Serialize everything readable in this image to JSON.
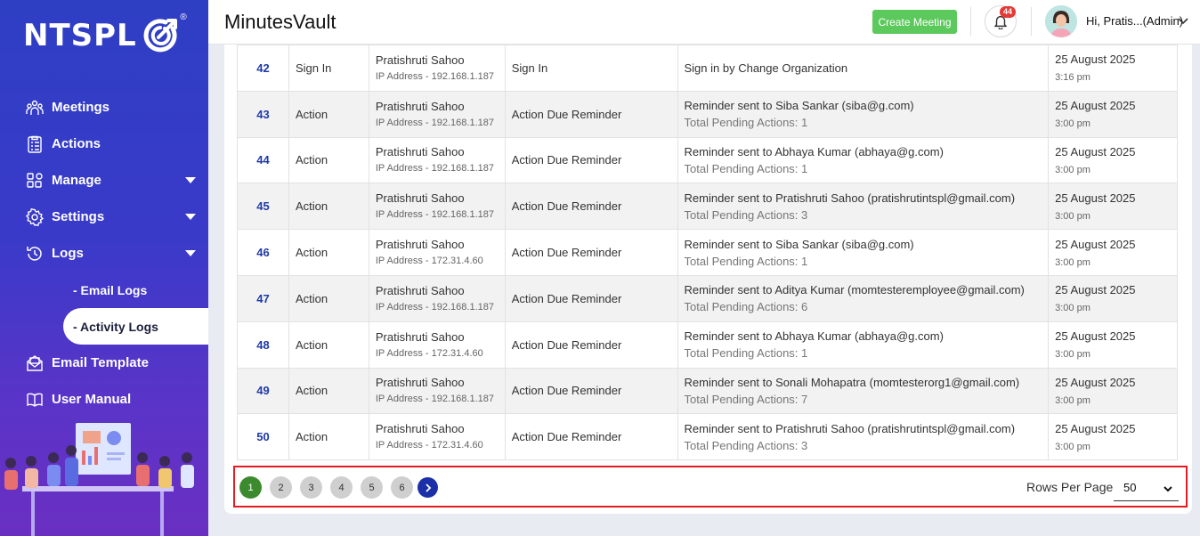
{
  "brand": {
    "logo_text": "NTSPL",
    "registered": "®"
  },
  "sidebar": {
    "items": [
      {
        "label": "Meetings",
        "icon": "meetings-icon"
      },
      {
        "label": "Actions",
        "icon": "actions-icon"
      },
      {
        "label": "Manage",
        "icon": "manage-icon"
      },
      {
        "label": "Settings",
        "icon": "gear-icon"
      },
      {
        "label": "Logs",
        "icon": "history-icon"
      }
    ],
    "sub_items": [
      {
        "label": "- Email Logs"
      },
      {
        "label": "- Activity Logs",
        "active": true
      }
    ],
    "bottom_items": [
      {
        "label": "Email Template",
        "icon": "email-icon"
      },
      {
        "label": "User Manual",
        "icon": "book-icon"
      }
    ]
  },
  "header": {
    "title": "MinutesVault",
    "create_button": "Create Meeting",
    "notification_count": "44",
    "user_name": "Hi, Pratis...(Admin)"
  },
  "table": {
    "rows": [
      {
        "num": "42",
        "type": "Sign In",
        "user": "Pratishruti Sahoo",
        "ip": "IP Address - 192.168.1.187",
        "action": "Sign In",
        "desc": "Sign in by Change Organization",
        "desc2": "",
        "date": "25 August 2025",
        "time": "3:16 pm"
      },
      {
        "num": "43",
        "type": "Action",
        "user": "Pratishruti Sahoo",
        "ip": "IP Address - 192.168.1.187",
        "action": "Action Due Reminder",
        "desc": "Reminder sent to Siba Sankar (siba@g.com)",
        "desc2": "Total Pending Actions: 1",
        "date": "25 August 2025",
        "time": "3:00 pm"
      },
      {
        "num": "44",
        "type": "Action",
        "user": "Pratishruti Sahoo",
        "ip": "IP Address - 192.168.1.187",
        "action": "Action Due Reminder",
        "desc": "Reminder sent to Abhaya Kumar (abhaya@g.com)",
        "desc2": "Total Pending Actions: 1",
        "date": "25 August 2025",
        "time": "3:00 pm"
      },
      {
        "num": "45",
        "type": "Action",
        "user": "Pratishruti Sahoo",
        "ip": "IP Address - 192.168.1.187",
        "action": "Action Due Reminder",
        "desc": "Reminder sent to Pratishruti Sahoo (pratishrutintspl@gmail.com)",
        "desc2": "Total Pending Actions: 3",
        "date": "25 August 2025",
        "time": "3:00 pm"
      },
      {
        "num": "46",
        "type": "Action",
        "user": "Pratishruti Sahoo",
        "ip": "IP Address - 172.31.4.60",
        "action": "Action Due Reminder",
        "desc": "Reminder sent to Siba Sankar (siba@g.com)",
        "desc2": "Total Pending Actions: 1",
        "date": "25 August 2025",
        "time": "3:00 pm"
      },
      {
        "num": "47",
        "type": "Action",
        "user": "Pratishruti Sahoo",
        "ip": "IP Address - 192.168.1.187",
        "action": "Action Due Reminder",
        "desc": "Reminder sent to Aditya Kumar (momtesteremployee@gmail.com)",
        "desc2": "Total Pending Actions: 6",
        "date": "25 August 2025",
        "time": "3:00 pm"
      },
      {
        "num": "48",
        "type": "Action",
        "user": "Pratishruti Sahoo",
        "ip": "IP Address - 172.31.4.60",
        "action": "Action Due Reminder",
        "desc": "Reminder sent to Abhaya Kumar (abhaya@g.com)",
        "desc2": "Total Pending Actions: 1",
        "date": "25 August 2025",
        "time": "3:00 pm"
      },
      {
        "num": "49",
        "type": "Action",
        "user": "Pratishruti Sahoo",
        "ip": "IP Address - 192.168.1.187",
        "action": "Action Due Reminder",
        "desc": "Reminder sent to Sonali Mohapatra (momtesterorg1@gmail.com)",
        "desc2": "Total Pending Actions: 7",
        "date": "25 August 2025",
        "time": "3:00 pm"
      },
      {
        "num": "50",
        "type": "Action",
        "user": "Pratishruti Sahoo",
        "ip": "IP Address - 172.31.4.60",
        "action": "Action Due Reminder",
        "desc": "Reminder sent to Pratishruti Sahoo (pratishrutintspl@gmail.com)",
        "desc2": "Total Pending Actions: 3",
        "date": "25 August 2025",
        "time": "3:00 pm"
      }
    ]
  },
  "pagination": {
    "pages": [
      "1",
      "2",
      "3",
      "4",
      "5",
      "6"
    ],
    "current": "1",
    "rows_per_page_label": "Rows Per Page",
    "rows_per_page_value": "50"
  },
  "colors": {
    "sidebar": "#3a3ac9",
    "accent_blue": "#1f3aa8",
    "create_green": "#5cc95c",
    "active_page": "#3b8a2e",
    "highlight_red": "#e31b23"
  }
}
